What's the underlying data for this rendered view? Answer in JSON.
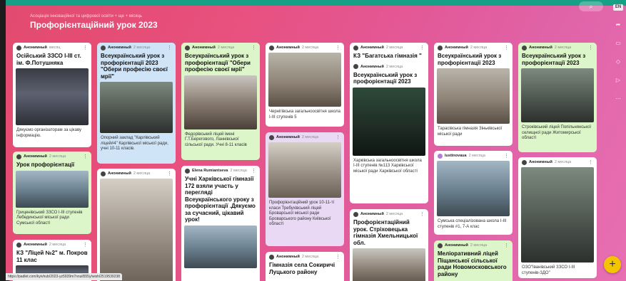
{
  "header": {
    "subtitle": "Асоціація інноваційної та цифрової освіти + ще + місяць",
    "title": "Профорієнтаційний урок 2023"
  },
  "toolbar": {
    "search_icon": "search-icon",
    "search_label": "⌕"
  },
  "rightbar": {
    "top_label": "EN",
    "icons": [
      "share-icon",
      "slideshow-icon",
      "remake-icon",
      "settings-icon",
      "more-icon"
    ]
  },
  "posts": {
    "p1": {
      "author": "Анонимный",
      "time": "месяц",
      "title": "Осійський ЗЗСО І-ІІІ ст. ім. Ф.Потушняка",
      "caption": "Дякуємо організаторам за цікаву інформацію."
    },
    "p2": {
      "author": "Анонимный",
      "time": "2 месяца",
      "title": "Урок профорієнтації",
      "caption": "Гриценівський ЗЗСО І-ІІІ ступенів Лебединської міської ради Сумської області"
    },
    "p3": {
      "author": "Анонимный",
      "time": "2 месяца",
      "title": "КЗ \"Ліцей №2\" м. Покров 11 клас",
      "caption": ""
    },
    "p4": {
      "author": "Анонимный",
      "time": "2 месяца",
      "title": "Всеукраїнський урок з профорієнтації 2023 \"Обери професію своєї мрії\"",
      "caption": "Опорний заклад \"Карлівський ліцей#4\" Карлівської міської ради, учні 10-11 класів."
    },
    "p5": {
      "author": "Анонимный",
      "time": "2 месяца",
      "title": "",
      "caption": ""
    },
    "p6": {
      "author": "Анонимный",
      "time": "2 месяца",
      "title": "Всеукраїнський урок з профорієнтації \"Обери професію своєї мрії\"",
      "caption": "Федорівський ліцей імені Г.Т.Берегового, Ланнівської сільської ради. Учні 8-11 класів"
    },
    "p7": {
      "author": "Elena Rumiantseva",
      "time": "2 месяца",
      "title": "Учні Харківської гімназії 172 взяли участь у перегляді Всеукраїнського уроку з профорієнтації .Дякуємо за сучасний, цікавий урок!",
      "caption": ""
    },
    "p8": {
      "author": "Анонимный",
      "time": "2 месяца",
      "title": "",
      "caption": "Чернігівська загальноосвітня школа І-ІІІ ступенів 5"
    },
    "p9": {
      "author": "Анонимный",
      "time": "2 месяца",
      "title": "",
      "caption": "Профорієнтаційний урок 10-11-ті класи Требухівський ліцей Броварської міської ради Броварського району Київської області"
    },
    "p10": {
      "author": "Анонимный",
      "time": "2 месяца",
      "title": "Гімназія села Сокиричі Луцького району",
      "caption": ""
    },
    "p11": {
      "author": "Анонимный",
      "time": "2 месяца",
      "title": "КЗ \"Багатська гімназія \"",
      "caption": ""
    },
    "p12": {
      "author": "Анонимный",
      "time": "2 месяца",
      "title": "Всеукраїнський урок з профорієнтації 2023",
      "caption": "Харківська загальноосвітня школа І-ІІІ ступенів №113 Харківської міської ради Харківської області"
    },
    "p13": {
      "author": "Анонимный",
      "time": "2 месяца",
      "title": "Профорієнтаційний урок. Стріховецька гімназія Хмельницької обл.",
      "caption": ""
    },
    "p14": {
      "author": "Анонимный",
      "time": "2 месяца",
      "title": "Всеукраїнський урок з профорієнтації 2023",
      "caption": "Тарасівська гімназія Зіньківської міської ради"
    },
    "p15": {
      "author": "lustinovaua",
      "time": "2 месяца",
      "title": "",
      "caption": "Сумська спеціалізована школа І-ІІІ ступенів #1, 7-А клас"
    },
    "p16": {
      "author": "Анонимный",
      "time": "2 месяца",
      "title": "Меліоративний ліцей Піщанської сільської ради Новомосковського району",
      "caption": ""
    },
    "p17": {
      "author": "Анонимный",
      "time": "2 месяца",
      "title": "Всеукраїнський урок з профорієнтації 2023",
      "caption": "Строківський ліцей Попільнянської селищної ради Житомирської області"
    },
    "p18": {
      "author": "Анонимный",
      "time": "2 месяца",
      "title": "",
      "caption": "ОЗО\"Іванівський ЗЗСО І-ІІІ ступенів-ЗДО\""
    }
  },
  "fab_label": "+",
  "status_url": "https://padlet.com/kyivhub/2023-yz5939m7nnuil555y/wish/2519539238"
}
